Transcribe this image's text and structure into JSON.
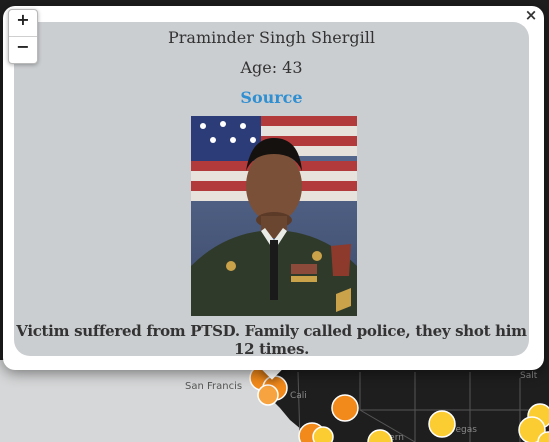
{
  "map": {
    "city_label": "San Francis",
    "zoom_in": "+",
    "zoom_out": "−",
    "marker_colors": [
      "#f28a1b",
      "#f7a440",
      "#fccc33",
      "#ffdd55"
    ],
    "background": "#1e1e1e"
  },
  "popup": {
    "close": "×",
    "name": "Praminder Singh Shergill",
    "age": "Age: 43",
    "source_label": "Source",
    "photo_icon": "portrait-photo",
    "description": "Victim suffered from PTSD. Family called police, they shot him 12 times."
  }
}
